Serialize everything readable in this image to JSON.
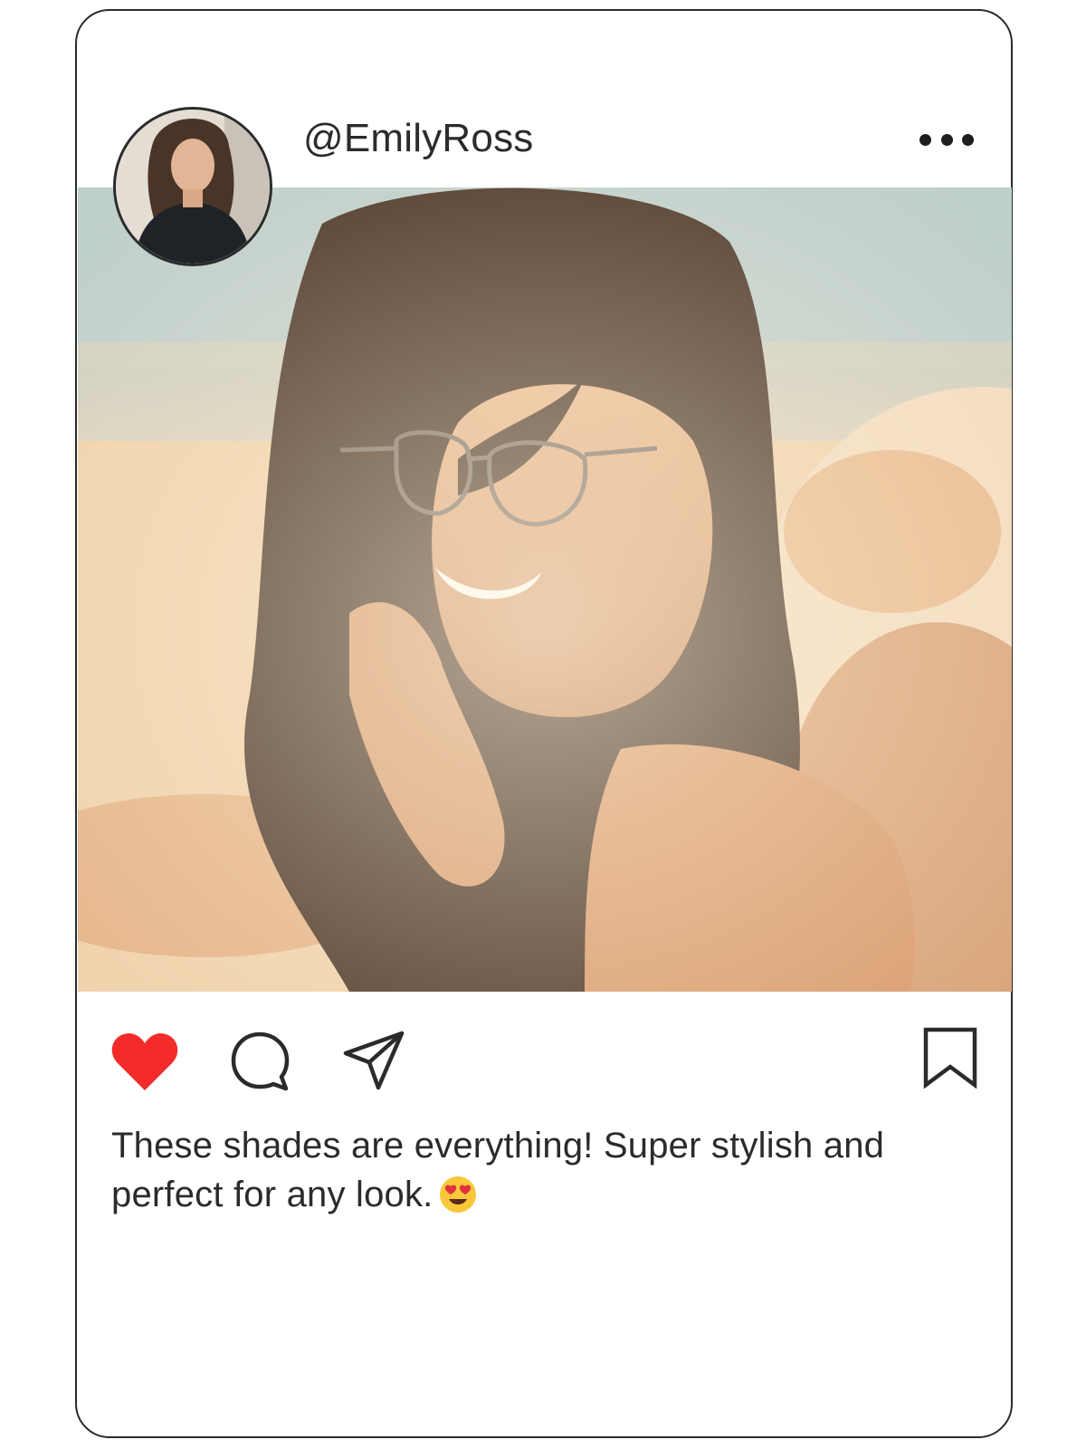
{
  "post": {
    "username": "@EmilyRoss",
    "caption": "These shades are everything! Super stylish and perfect for any look.",
    "caption_emoji": "heart-eyes-emoji",
    "liked": true
  },
  "icons": {
    "more": "more-dots-icon",
    "like": "heart-icon",
    "comment": "comment-bubble-icon",
    "share": "paper-plane-icon",
    "save": "bookmark-icon"
  },
  "colors": {
    "heart": "#f32b2b",
    "text": "#2b2b2b",
    "border": "#2b2b2b"
  }
}
